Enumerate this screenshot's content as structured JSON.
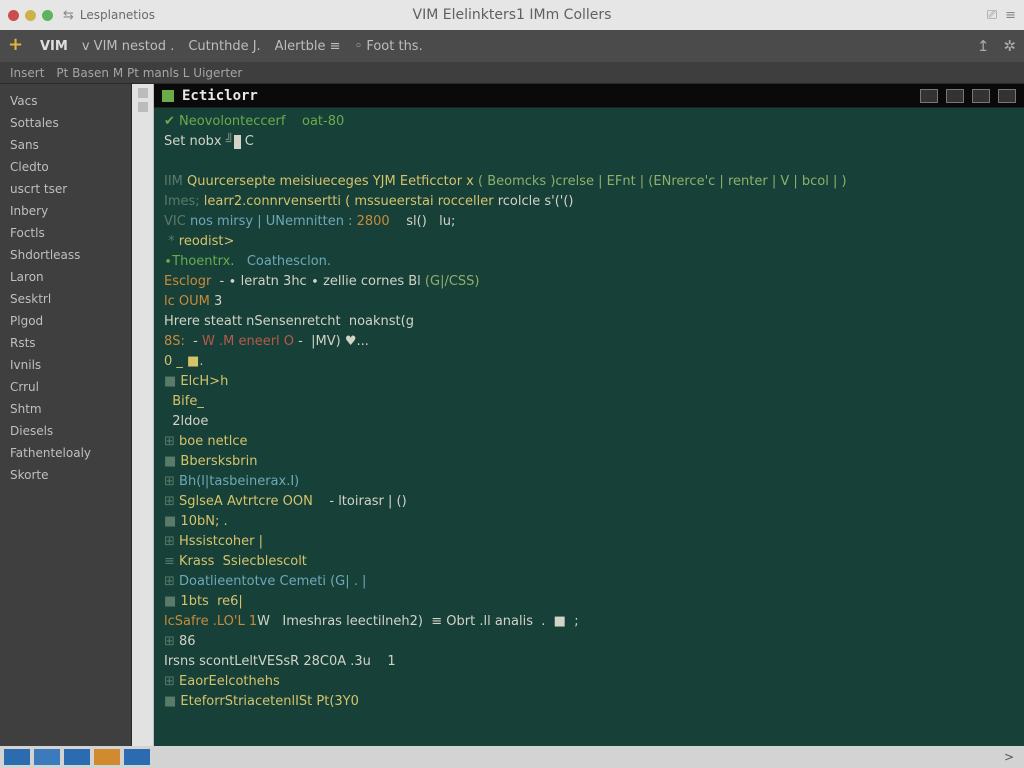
{
  "titlebar": {
    "subtitle": "Lesplanetios",
    "center": "VIM Elelinkters1 IMm Collers"
  },
  "toolbar": {
    "items": [
      "VIM",
      "v VIM nestod .",
      "Cutnthde J.",
      "Alertble ≡",
      "◦ Foot ths."
    ]
  },
  "tabstrip": {
    "tabs": [
      "Insert",
      "Pt Basen  M Pt manls  L Uigerter"
    ]
  },
  "sidebar": {
    "items": [
      "Vacs",
      "Sottales",
      "Sans",
      "Cledto",
      "uscrt tser",
      "Inbery",
      "Foctls",
      "Shdortleass",
      "Laron",
      "Sesktrl",
      "Plgod",
      "Rsts",
      "Ivnils",
      "Crrul",
      "Shtm",
      "Diesels",
      "Fathenteloaly",
      "Skorte"
    ]
  },
  "editor": {
    "filename": "Ecticlorr",
    "header_left": "Neovolonteccerf",
    "header_right": "oat-80",
    "line_set": "Set nobx",
    "lines": [
      {
        "pre": "IIM ",
        "ye": "Quurcersepte meisiueceges YJM Eetficctor x ",
        "tag": "( Beomcks )crelse | EFnt | (ENrerce'c | renter | V | bcol | )"
      },
      {
        "pre": "Imes; ",
        "ye": "learr2.connrvensertti ( mssueerstai rocceller",
        "wh": " rcolcle s'('()"
      },
      {
        "pre": "",
        "wh": ""
      },
      {
        "pre": "VIC ",
        "bl": "nos mirsy | UNemnitten : ",
        "or": "2800",
        "wh": "    sl()   lu;"
      },
      {
        "pre": " * ",
        "ye": "reodist>"
      },
      {
        "pre": "",
        "gr": "∙Thoentrx",
        "bl": ".   Coathesclon.  "
      },
      {
        "pre": "",
        "wh": ""
      },
      {
        "pre": "",
        "wh": "  - ∙ leratn 3hc ∙ zellie cornes Bl ",
        "or": "Esclogr",
        "tag": "(G|/CSS)"
      },
      {
        "pre": "",
        "wh": " 3",
        "or": "lc OUM"
      },
      {
        "pre": "",
        "wh": "Hrere steatt nSensenretcht  noaknst(g"
      },
      {
        "pre": "",
        "wh": "  - ",
        "rd": "W .M eneerl O",
        "or": "8S:",
        "wh2": " -  |MV) ♥..."
      },
      {
        "pre": "",
        "ye": "0 _ ■."
      },
      {
        "pre": "■ ",
        "ye": "ElcH>h"
      },
      {
        "pre": "  ",
        "ye": "Bife_"
      },
      {
        "pre": "  ",
        "wh": "2ldoe"
      },
      {
        "pre": "⊞ ",
        "ye": "boe netlce"
      },
      {
        "pre": "■ ",
        "ye": "Bbersksbrin"
      },
      {
        "pre": "⊞ ",
        "bl": "Bh(l|tasbeinerax.I) "
      },
      {
        "pre": "⊞ ",
        "ye": "SglseA Avtrtcre OON",
        "wh": "    - ltoirasr | ()"
      },
      {
        "pre": "■ ",
        "ye": "10bN; ."
      },
      {
        "pre": "⊞ ",
        "ye": "Hssistcoher |"
      },
      {
        "pre": "≡ ",
        "ye": "Krass  Ssiecblescolt"
      },
      {
        "pre": "⊞ ",
        "bl": "Doatlieentotve Cemeti (G| . |"
      },
      {
        "pre": "■ ",
        "ye": "1bts  re6|"
      },
      {
        "pre": "",
        "wh": "W   Imeshras leectilneh2)  ≡ Obrt .ll analis  ",
        "or": "lcSafre .LO'L 1",
        "wh2": ".  ■  ;"
      },
      {
        "pre": "⊞ ",
        "wh": "86"
      },
      {
        "pre": "",
        "wh": "Irsns scontLeltVESsR 28C0A .3u    1"
      },
      {
        "pre": "⊞ ",
        "ye": "EaorEelcothehs"
      },
      {
        "pre": "■ ",
        "ye": "EteforrStriacetenlISt Pt(3Y0"
      }
    ]
  },
  "taskbar": {
    "right_text": ">"
  }
}
